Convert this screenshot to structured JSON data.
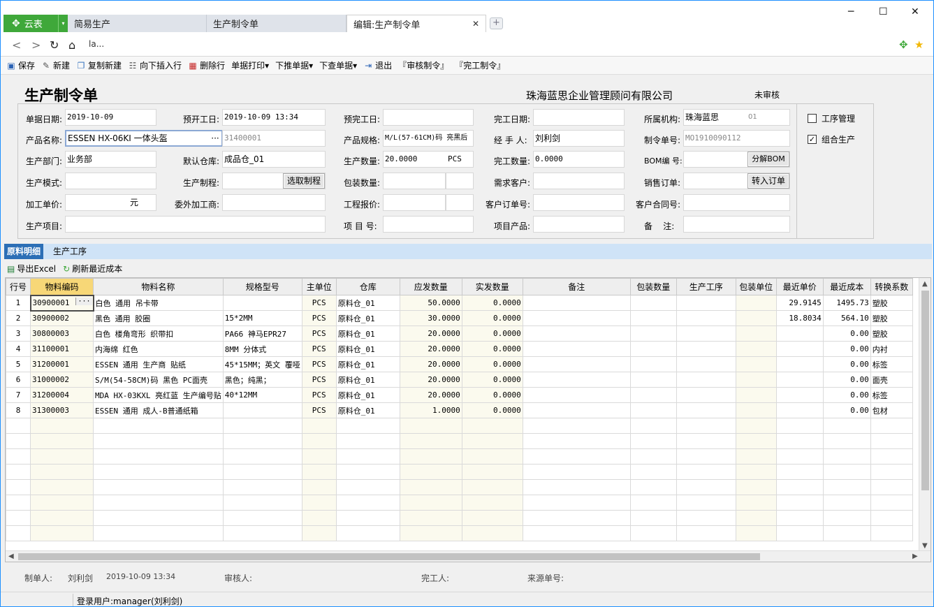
{
  "tabs": {
    "home": "云表",
    "t1": "简易生产",
    "t2": "生产制令单",
    "t3": "编辑:生产制令单"
  },
  "nav": {
    "url": "la..."
  },
  "toolbar": [
    {
      "label": "保存",
      "icon": "save-icon"
    },
    {
      "label": "新建",
      "icon": "new-icon"
    },
    {
      "label": "复制新建",
      "icon": "copy-icon"
    },
    {
      "label": "向下插入行",
      "icon": "insert-row-icon"
    },
    {
      "label": "删除行",
      "icon": "delete-row-icon"
    },
    {
      "label": "单据打印▾",
      "icon": ""
    },
    {
      "label": "下推单据▾",
      "icon": ""
    },
    {
      "label": "下查单据▾",
      "icon": ""
    },
    {
      "label": "退出",
      "icon": "exit-icon"
    },
    {
      "label": "『审核制令』",
      "icon": ""
    },
    {
      "label": "『完工制令』",
      "icon": ""
    }
  ],
  "header": {
    "title": "生产制令单",
    "company": "珠海蓝思企业管理顾问有限公司",
    "status": "未审核"
  },
  "form": {
    "l_date": "单据日期:",
    "v_date": "2019-10-09",
    "l_plan_start": "预开工日:",
    "v_plan_start": "2019-10-09 13:34",
    "l_plan_end": "预完工日:",
    "v_plan_end": "",
    "l_done_date": "完工日期:",
    "v_done_date": "",
    "l_org": "所属机构:",
    "v_org": "珠海蓝思",
    "v_org_code": "01",
    "l_product": "产品名称:",
    "v_product": "ESSEN HX-06KI 一体头盔",
    "v_product_code": "31400001",
    "l_spec": "产品规格:",
    "v_spec": "M/L(57-61CM)码 亮黑后",
    "l_handler": "经 手 人:",
    "v_handler": "刘利剑",
    "l_order_no": "制令单号:",
    "v_order_no": "MO1910090112",
    "l_dept": "生产部门:",
    "v_dept": "业务部",
    "l_warehouse": "默认仓库:",
    "v_warehouse": "成品仓_01",
    "l_qty": "生产数量:",
    "v_qty": "20.0000",
    "v_qty_unit": "PCS",
    "l_done_qty": "完工数量:",
    "v_done_qty": "0.0000",
    "l_bom": "BOM编 号:",
    "btn_bom": "分解BOM",
    "l_mode": "生产模式:",
    "l_process": "生产制程:",
    "btn_process": "选取制程",
    "l_pack_qty": "包装数量:",
    "l_customer": "需求客户:",
    "l_sales": "销售订单:",
    "btn_sales": "转入订单",
    "l_price": "加工单价:",
    "v_price_unit": "元",
    "l_outsource": "委外加工商:",
    "l_quote": "工程报价:",
    "l_cust_order": "客户订单号:",
    "l_contract": "客户合同号:",
    "l_project": "生产项目:",
    "l_item_no": "项 目 号:",
    "l_proj_product": "项目产品:",
    "l_remark": "备    注:",
    "chk_process": "工序管理",
    "chk_combo": "组合生产"
  },
  "section": {
    "tab_materials": "原料明细",
    "tab_process": "生产工序",
    "export": "导出Excel",
    "refresh": "刷新最近成本"
  },
  "grid": {
    "headers": [
      "行号",
      "物料编码",
      "物料名称",
      "规格型号",
      "主单位",
      "仓库",
      "应发数量",
      "实发数量",
      "备注",
      "包装数量",
      "生产工序",
      "包装单位",
      "最近单价",
      "最近成本",
      "转换系数"
    ],
    "rows": [
      [
        "1",
        "30900001",
        "白色 通用 吊卡带",
        "",
        "PCS",
        "原料仓_01",
        "50.0000",
        "0.0000",
        "",
        "",
        "",
        "",
        "29.9145",
        "1495.73",
        "塑胶"
      ],
      [
        "2",
        "30900002",
        "黑色 通用 胶圈",
        "15*2MM",
        "PCS",
        "原料仓_01",
        "30.0000",
        "0.0000",
        "",
        "",
        "",
        "",
        "18.8034",
        "564.10",
        "塑胶"
      ],
      [
        "3",
        "30800003",
        "白色 楼角弯形 织带扣",
        "PA66 神马EPR27",
        "PCS",
        "原料仓_01",
        "20.0000",
        "0.0000",
        "",
        "",
        "",
        "",
        "",
        "0.00",
        "塑胶"
      ],
      [
        "4",
        "31100001",
        "内海绵 红色",
        "8MM 分体式",
        "PCS",
        "原料仓_01",
        "20.0000",
        "0.0000",
        "",
        "",
        "",
        "",
        "",
        "0.00",
        "内衬"
      ],
      [
        "5",
        "31200001",
        "ESSEN 通用 生产商 贴纸",
        "45*15MM；英文 覆哑",
        "PCS",
        "原料仓_01",
        "20.0000",
        "0.0000",
        "",
        "",
        "",
        "",
        "",
        "0.00",
        "标签"
      ],
      [
        "6",
        "31000002",
        "S/M(54-58CM)码 黑色 PC面壳",
        "黑色；纯黑；",
        "PCS",
        "原料仓_01",
        "20.0000",
        "0.0000",
        "",
        "",
        "",
        "",
        "",
        "0.00",
        "面壳"
      ],
      [
        "7",
        "31200004",
        "MDA HX-03KXL 亮红蓝 生产编号贴",
        "40*12MM",
        "PCS",
        "原料仓_01",
        "20.0000",
        "0.0000",
        "",
        "",
        "",
        "",
        "",
        "0.00",
        "标签"
      ],
      [
        "8",
        "31300003",
        "ESSEN 通用 成人-B普通纸箱",
        "",
        "PCS",
        "原料仓_01",
        "1.0000",
        "0.0000",
        "",
        "",
        "",
        "",
        "",
        "0.00",
        "包材"
      ]
    ]
  },
  "footer": {
    "l_maker": "制单人:",
    "v_maker": "刘利剑",
    "v_make_time": "2019-10-09 13:34",
    "l_auditor": "审核人:",
    "l_finisher": "完工人:",
    "l_source": "来源单号:"
  },
  "statusbar": {
    "user": "登录用户:manager(刘利剑)"
  }
}
